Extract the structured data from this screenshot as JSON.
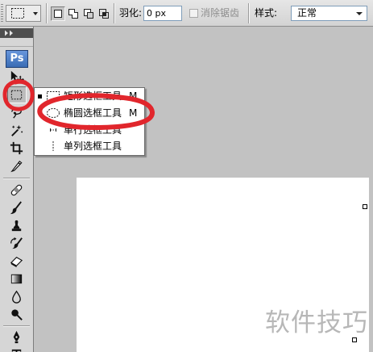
{
  "colors": {
    "annotation_red": "#e1262c",
    "canvas_gray": "#c2c2c2",
    "panel_gray": "#d6d6d6",
    "logo_blue": "#3a6cb4",
    "menu_bg": "#ffffff"
  },
  "options_bar": {
    "tool_preset_icon": "rect-marquee-icon",
    "selection_modes": [
      "new-selection-icon",
      "add-to-selection-icon",
      "subtract-from-selection-icon",
      "intersect-selection-icon"
    ],
    "active_mode": "new-selection-icon",
    "feather_label": "羽化:",
    "feather_value": "0 px",
    "antialias_label": "消除锯齿",
    "antialias_checked": false,
    "antialias_enabled": false,
    "style_label": "样式:",
    "style_value": "正常"
  },
  "toolbox": {
    "header_icon": "expand-panel-icon",
    "logo": "Ps",
    "tools": [
      "move-tool-icon",
      "rect-marquee-tool-icon",
      "lasso-tool-icon",
      "magic-wand-tool-icon",
      "crop-tool-icon",
      "slice-tool-icon",
      "healing-brush-tool-icon",
      "brush-tool-icon",
      "clone-stamp-tool-icon",
      "history-brush-tool-icon",
      "eraser-tool-icon",
      "gradient-tool-icon",
      "blur-tool-icon",
      "dodge-tool-icon",
      "pen-tool-icon",
      "type-tool-icon"
    ],
    "active_tool": "rect-marquee-tool-icon"
  },
  "flyout": {
    "items": [
      {
        "icon": "rect-marquee-icon",
        "label": "矩形选框工具",
        "shortcut": "M",
        "current": true
      },
      {
        "icon": "ellipse-marquee-icon",
        "label": "椭圆选框工具",
        "shortcut": "M",
        "current": false
      },
      {
        "icon": "single-row-marquee-icon",
        "label": "单行选框工具",
        "current": false
      },
      {
        "icon": "single-column-marquee-icon",
        "label": "单列选框工具",
        "current": false
      }
    ]
  },
  "watermark": "软件技巧"
}
